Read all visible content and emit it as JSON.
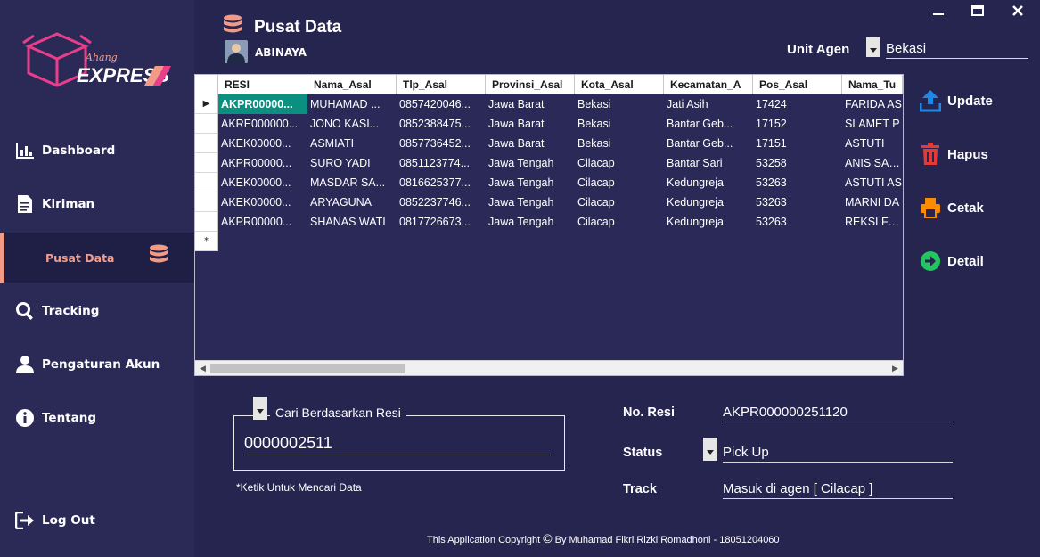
{
  "app": {
    "logo_script": "Ahang",
    "logo_brand": "EXPRESS"
  },
  "window": {
    "minimize_icon": "minimize-icon",
    "maximize_icon": "maximize-icon",
    "close_icon": "close-icon"
  },
  "sidebar": {
    "items": [
      {
        "label": "Dashboard",
        "icon": "bar-chart-icon"
      },
      {
        "label": "Kiriman",
        "icon": "document-icon"
      },
      {
        "label": "Pusat Data",
        "icon": "database-icon"
      },
      {
        "label": "Tracking",
        "icon": "search-icon"
      },
      {
        "label": "Pengaturan Akun",
        "icon": "user-icon"
      },
      {
        "label": "Tentang",
        "icon": "info-icon"
      }
    ],
    "logout": {
      "label": "Log Out",
      "icon": "logout-icon"
    }
  },
  "header": {
    "title": "Pusat Data",
    "user_name": "ABINAYA",
    "unit_label": "Unit Agen",
    "unit_value": "Bekasi"
  },
  "grid": {
    "columns": [
      "RESI",
      "Nama_Asal",
      "Tlp_Asal",
      "Provinsi_Asal",
      "Kota_Asal",
      "Kecamatan_A",
      "Pos_Asal",
      "Nama_Tu"
    ],
    "rows": [
      [
        "AKPR00000...",
        "MUHAMAD ...",
        "0857420046...",
        "Jawa Barat",
        "Bekasi",
        "Jati Asih",
        "17424",
        "FARIDA AS"
      ],
      [
        "AKRE000000...",
        "JONO KASI...",
        "0852388475...",
        "Jawa Barat",
        "Bekasi",
        "Bantar Geb...",
        "17152",
        "SLAMET P"
      ],
      [
        "AKEK00000...",
        "ASMIATI",
        "0857736452...",
        "Jawa Barat",
        "Bekasi",
        "Bantar Geb...",
        "17151",
        "ASTUTI"
      ],
      [
        "AKPR00000...",
        "SURO YADI",
        "0851123774...",
        "Jawa Tengah",
        "Cilacap",
        "Bantar Sari",
        "53258",
        "ANIS SANT"
      ],
      [
        "AKEK00000...",
        "MASDAR SA...",
        "0816625377...",
        "Jawa Tengah",
        "Cilacap",
        "Kedungreja",
        "53263",
        "ASTUTI AS"
      ],
      [
        "AKEK00000...",
        "ARYAGUNA",
        "0852237746...",
        "Jawa Tengah",
        "Cilacap",
        "Kedungreja",
        "53263",
        "MARNI DA"
      ],
      [
        "AKPR00000...",
        "SHANAS WATI",
        "0817726673...",
        "Jawa Tengah",
        "Cilacap",
        "Kedungreja",
        "53263",
        "REKSI FER"
      ]
    ],
    "current_row_marker": "▶",
    "new_row_marker": "*"
  },
  "actions": [
    {
      "label": "Update",
      "icon": "upload-icon",
      "color": "#1e88e5"
    },
    {
      "label": "Hapus",
      "icon": "trash-icon",
      "color": "#e53935"
    },
    {
      "label": "Cetak",
      "icon": "printer-icon",
      "color": "#fb8c00"
    },
    {
      "label": "Detail",
      "icon": "arrow-right-circle-icon",
      "color": "#22c55e"
    }
  ],
  "search": {
    "legend": "Cari Berdasarkan Resi",
    "value": "0000002511",
    "hint": "*Ketik Untuk Mencari Data"
  },
  "detail": {
    "resi_label": "No. Resi",
    "resi_value": "AKPR000000251120",
    "status_label": "Status",
    "status_value": "Pick Up",
    "track_label": "Track",
    "track_value": "Masuk di agen [ Cilacap ]"
  },
  "footer": {
    "text": "This Application Copyright",
    "copyright_symbol": "©",
    "author": "By Muhamad Fikri Rizki Romadhoni - 18051204060"
  },
  "colors": {
    "background": "#262550",
    "sidebar": "#2b2a57",
    "active_accent": "#f19a86",
    "selected_cell": "#0b8f80"
  }
}
